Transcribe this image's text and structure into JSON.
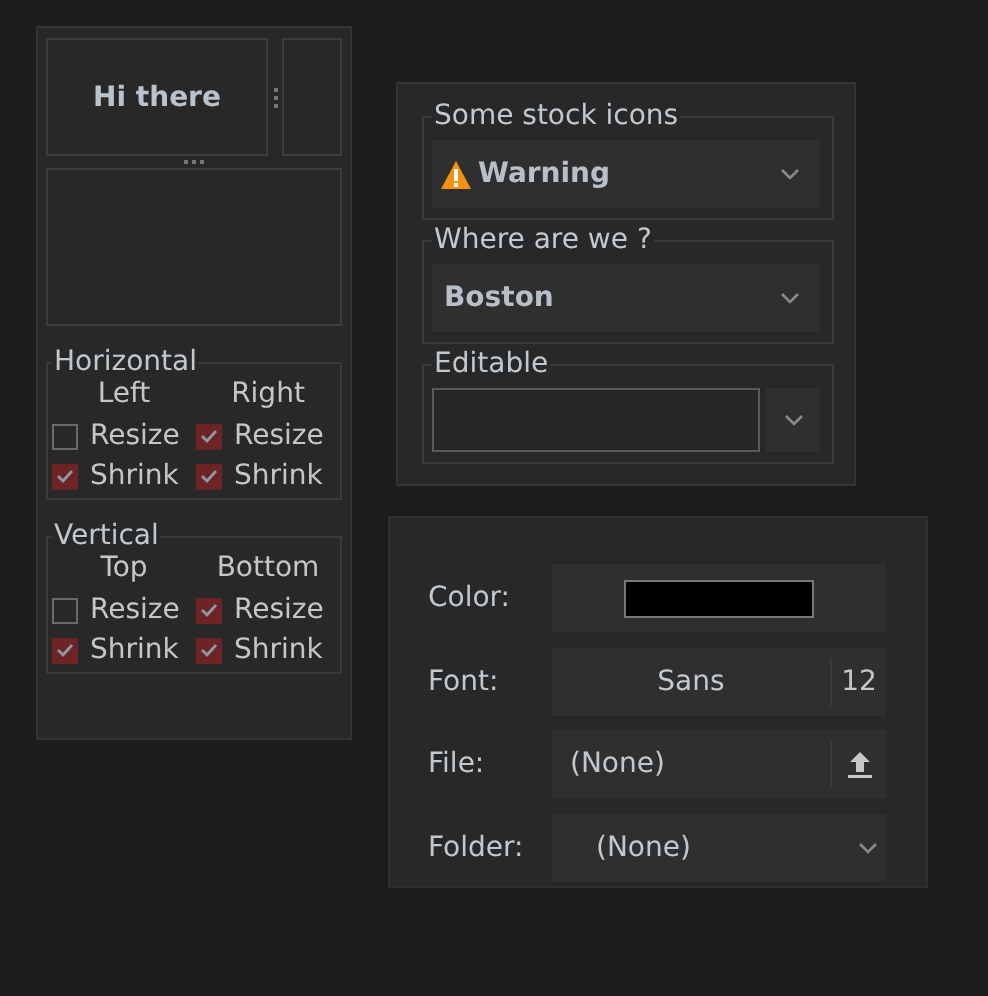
{
  "paned": {
    "label": "Hi there"
  },
  "frames": [
    {
      "title": "Horizontal",
      "columns": [
        {
          "heading": "Left",
          "options": [
            {
              "label": "Resize",
              "checked": false
            },
            {
              "label": "Shrink",
              "checked": true
            }
          ]
        },
        {
          "heading": "Right",
          "options": [
            {
              "label": "Resize",
              "checked": true
            },
            {
              "label": "Shrink",
              "checked": true
            }
          ]
        }
      ]
    },
    {
      "title": "Vertical",
      "columns": [
        {
          "heading": "Top",
          "options": [
            {
              "label": "Resize",
              "checked": false
            },
            {
              "label": "Shrink",
              "checked": true
            }
          ]
        },
        {
          "heading": "Bottom",
          "options": [
            {
              "label": "Resize",
              "checked": true
            },
            {
              "label": "Shrink",
              "checked": true
            }
          ]
        }
      ]
    }
  ],
  "combo_frames": [
    {
      "title": "Some stock icons",
      "kind": "icon-combo",
      "value": "Warning"
    },
    {
      "title": "Where are we ?",
      "kind": "combo",
      "value": "Boston"
    },
    {
      "title": "Editable",
      "kind": "entry-combo"
    }
  ],
  "pickers": [
    {
      "label": "Color:",
      "kind": "color",
      "color": "#000000"
    },
    {
      "label": "Font:",
      "kind": "font",
      "value": "Sans",
      "size": "12"
    },
    {
      "label": "File:",
      "kind": "file",
      "value": "(None)"
    },
    {
      "label": "Folder:",
      "kind": "folder",
      "value": "(None)"
    }
  ]
}
